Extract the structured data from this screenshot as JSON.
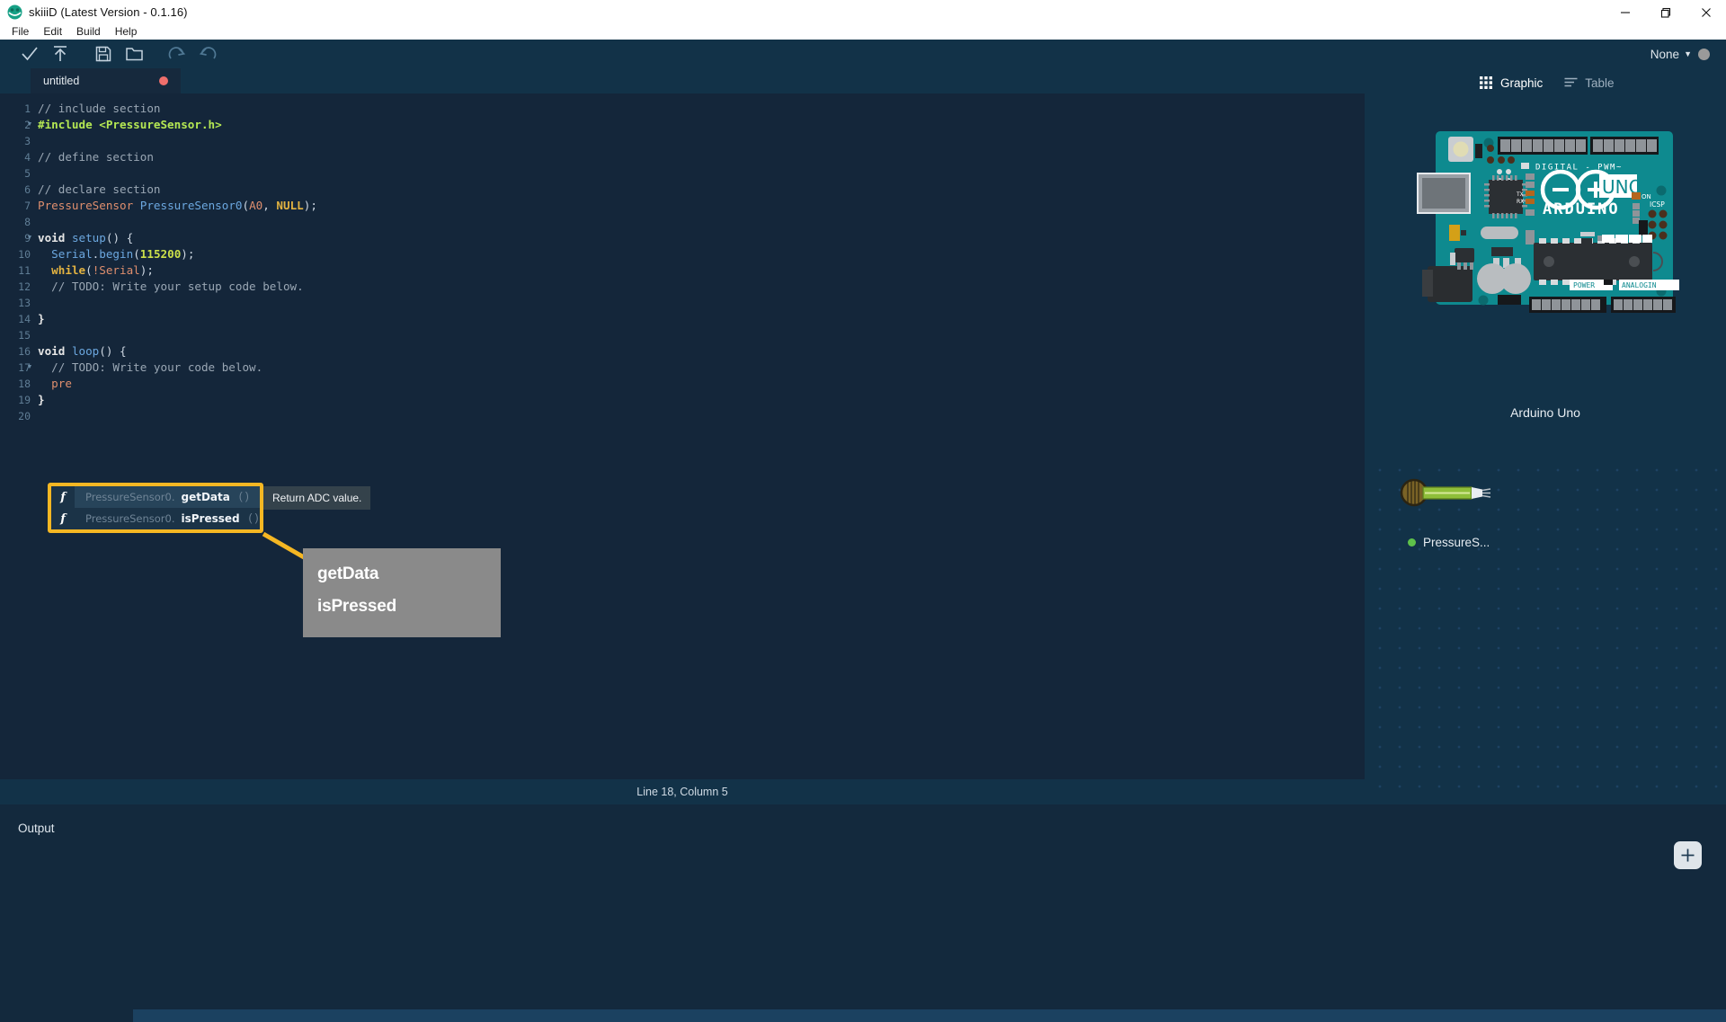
{
  "window": {
    "title": "skiiiD (Latest Version - 0.1.16)",
    "logo_icon": "skiiid-logo-icon",
    "minimize_icon": "minimize-icon",
    "maximize_icon": "restore-icon",
    "close_icon": "close-icon"
  },
  "menu": {
    "items": [
      {
        "label": "File"
      },
      {
        "label": "Edit"
      },
      {
        "label": "Build"
      },
      {
        "label": "Help"
      }
    ]
  },
  "toolbar": {
    "buttons": [
      {
        "icon": "check-icon",
        "name": "verify-button"
      },
      {
        "icon": "upload-arrow-icon",
        "name": "upload-button"
      },
      {
        "icon": "save-icon",
        "name": "save-button"
      },
      {
        "icon": "folder-open-icon",
        "name": "open-button"
      },
      {
        "icon": "redo-icon",
        "name": "redo-button"
      },
      {
        "icon": "undo-icon",
        "name": "undo-button"
      }
    ],
    "board_select": "None",
    "caret_glyph": "▼",
    "connection_color": "#9a9a9a"
  },
  "editor": {
    "tab": {
      "label": "untitled",
      "modified_dot_color": "#ef6f6c"
    },
    "line_count": 20,
    "lines": [
      {
        "n": 1,
        "fold": false
      },
      {
        "n": 2,
        "fold": true
      },
      {
        "n": 3,
        "fold": false
      },
      {
        "n": 4,
        "fold": false
      },
      {
        "n": 5,
        "fold": false
      },
      {
        "n": 6,
        "fold": false
      },
      {
        "n": 7,
        "fold": false
      },
      {
        "n": 8,
        "fold": false
      },
      {
        "n": 9,
        "fold": true
      },
      {
        "n": 10,
        "fold": false
      },
      {
        "n": 11,
        "fold": false
      },
      {
        "n": 12,
        "fold": false
      },
      {
        "n": 13,
        "fold": false
      },
      {
        "n": 14,
        "fold": false
      },
      {
        "n": 15,
        "fold": false
      },
      {
        "n": 16,
        "fold": true
      },
      {
        "n": 17,
        "fold": false
      },
      {
        "n": 18,
        "fold": false
      },
      {
        "n": 19,
        "fold": false
      },
      {
        "n": 20,
        "fold": false
      }
    ],
    "code_text": [
      "// include section",
      "#include <PressureSensor.h>",
      "",
      "// define section",
      "",
      "// declare section",
      "PressureSensor PressureSensor0(A0, NULL);",
      "",
      "void setup() {",
      "  Serial.begin(115200);",
      "  while(!Serial);",
      "  // TODO: Write your setup code below.",
      "",
      "}",
      "",
      "void loop() {",
      "  // TODO: Write your code below.",
      "  pre",
      "}",
      ""
    ],
    "typed_token": "pre",
    "status": "Line 18, Column 5"
  },
  "autocomplete": {
    "items": [
      {
        "prefix": "PressureSensor0.",
        "name": "getData",
        "parens": "( )",
        "icon": "function-icon"
      },
      {
        "prefix": "PressureSensor0.",
        "name": "isPressed",
        "parens": "( )",
        "icon": "function-icon"
      }
    ],
    "tooltip": "Return ADC value.",
    "highlight_color": "#f5b723"
  },
  "callout": {
    "lines": [
      "getData",
      "isPressed"
    ],
    "background": "#8a8a8a",
    "line_color": "#f5b723"
  },
  "right_panel": {
    "tabs": [
      {
        "label": "Graphic",
        "icon": "grid-icon",
        "active": true
      },
      {
        "label": "Table",
        "icon": "list-icon",
        "active": false
      }
    ],
    "board": {
      "name": "Arduino Uno",
      "icon": "arduino-uno-board-icon"
    },
    "components": [
      {
        "label": "PressureS...",
        "status_color": "#5ec14a",
        "icon": "pressure-sensor-icon"
      }
    ],
    "add_button": {
      "label": "+",
      "icon": "plus-icon"
    }
  },
  "output": {
    "title": "Output",
    "content": ""
  }
}
